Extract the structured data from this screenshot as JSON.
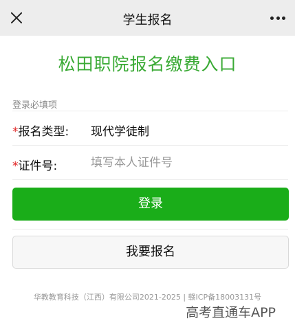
{
  "nav": {
    "title": "学生报名",
    "close_icon": "close-icon",
    "more_icon": "more-dots-icon"
  },
  "page": {
    "title": "松田职院报名缴费入口"
  },
  "form": {
    "section_label": "登录必填项",
    "required_mark": "*",
    "type_label": "报名类型:",
    "type_value": "现代学徒制",
    "id_label": "证件号:",
    "id_placeholder": "填写本人证件号",
    "id_value": ""
  },
  "actions": {
    "login_label": "登录",
    "register_label": "我要报名"
  },
  "footer": {
    "copyright": "华教教育科技（江西）有限公司2021-2025 | 赣ICP备18003131号"
  },
  "watermark": {
    "text": "高考直通车APP"
  },
  "colors": {
    "title_green": "#3aaa35",
    "button_green": "#1aad19",
    "required_red": "#e02020",
    "topbar_bg": "#ededed"
  }
}
